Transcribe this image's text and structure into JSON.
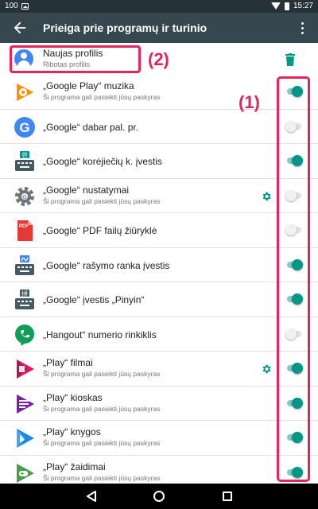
{
  "status_bar": {
    "battery_text": "100",
    "time": "15:27"
  },
  "app_bar": {
    "title": "Prieiga prie programų ir turinio"
  },
  "profile": {
    "name": "Naujas profilis",
    "subtitle": "Ribotas profilis"
  },
  "annotations": {
    "label_1": "(1)",
    "label_2": "(2)",
    "highlight_color": "#e6245c"
  },
  "colors": {
    "toggle_on": "#009688",
    "app_bar": "#37474f",
    "status_bar": "#263238"
  },
  "apps": [
    {
      "name": "„Google Play“ muzika",
      "subtitle": "Ši programa gali pasiekti jūsų paskyras",
      "icon": "play-music-icon",
      "settings": false,
      "enabled": true
    },
    {
      "name": "„Google“ dabar pal. pr.",
      "subtitle": "",
      "icon": "google-g-icon",
      "settings": false,
      "enabled": false
    },
    {
      "name": "„Google“ korėjiečių k. įvestis",
      "subtitle": "",
      "icon": "korean-keyboard-icon",
      "settings": false,
      "enabled": true
    },
    {
      "name": "„Google“ nustatymai",
      "subtitle": "Ši programa gali pasiekti jūsų paskyras",
      "icon": "google-settings-icon",
      "settings": true,
      "enabled": false
    },
    {
      "name": "„Google“ PDF failų žiūryklė",
      "subtitle": "",
      "icon": "pdf-viewer-icon",
      "settings": false,
      "enabled": false
    },
    {
      "name": "„Google“ rašymo ranka įvestis",
      "subtitle": "",
      "icon": "handwriting-keyboard-icon",
      "settings": false,
      "enabled": true
    },
    {
      "name": "„Google“ įvestis „Pinyin“",
      "subtitle": "",
      "icon": "pinyin-keyboard-icon",
      "settings": false,
      "enabled": true
    },
    {
      "name": "„Hangout“ numerio rinkiklis",
      "subtitle": "",
      "icon": "hangouts-dialer-icon",
      "settings": false,
      "enabled": false
    },
    {
      "name": "„Play“ filmai",
      "subtitle": "Ši programa gali pasiekti jūsų paskyras",
      "icon": "play-movies-icon",
      "settings": true,
      "enabled": true
    },
    {
      "name": "„Play“ kioskas",
      "subtitle": "Ši programa gali pasiekti jūsų paskyras",
      "icon": "play-newsstand-icon",
      "settings": false,
      "enabled": true
    },
    {
      "name": "„Play“ knygos",
      "subtitle": "Ši programa gali pasiekti jūsų paskyras",
      "icon": "play-books-icon",
      "settings": false,
      "enabled": true
    },
    {
      "name": "„Play“ žaidimai",
      "subtitle": "Ši programa gali pasiekti jūsų paskyras",
      "icon": "play-games-icon",
      "settings": false,
      "enabled": true
    }
  ]
}
